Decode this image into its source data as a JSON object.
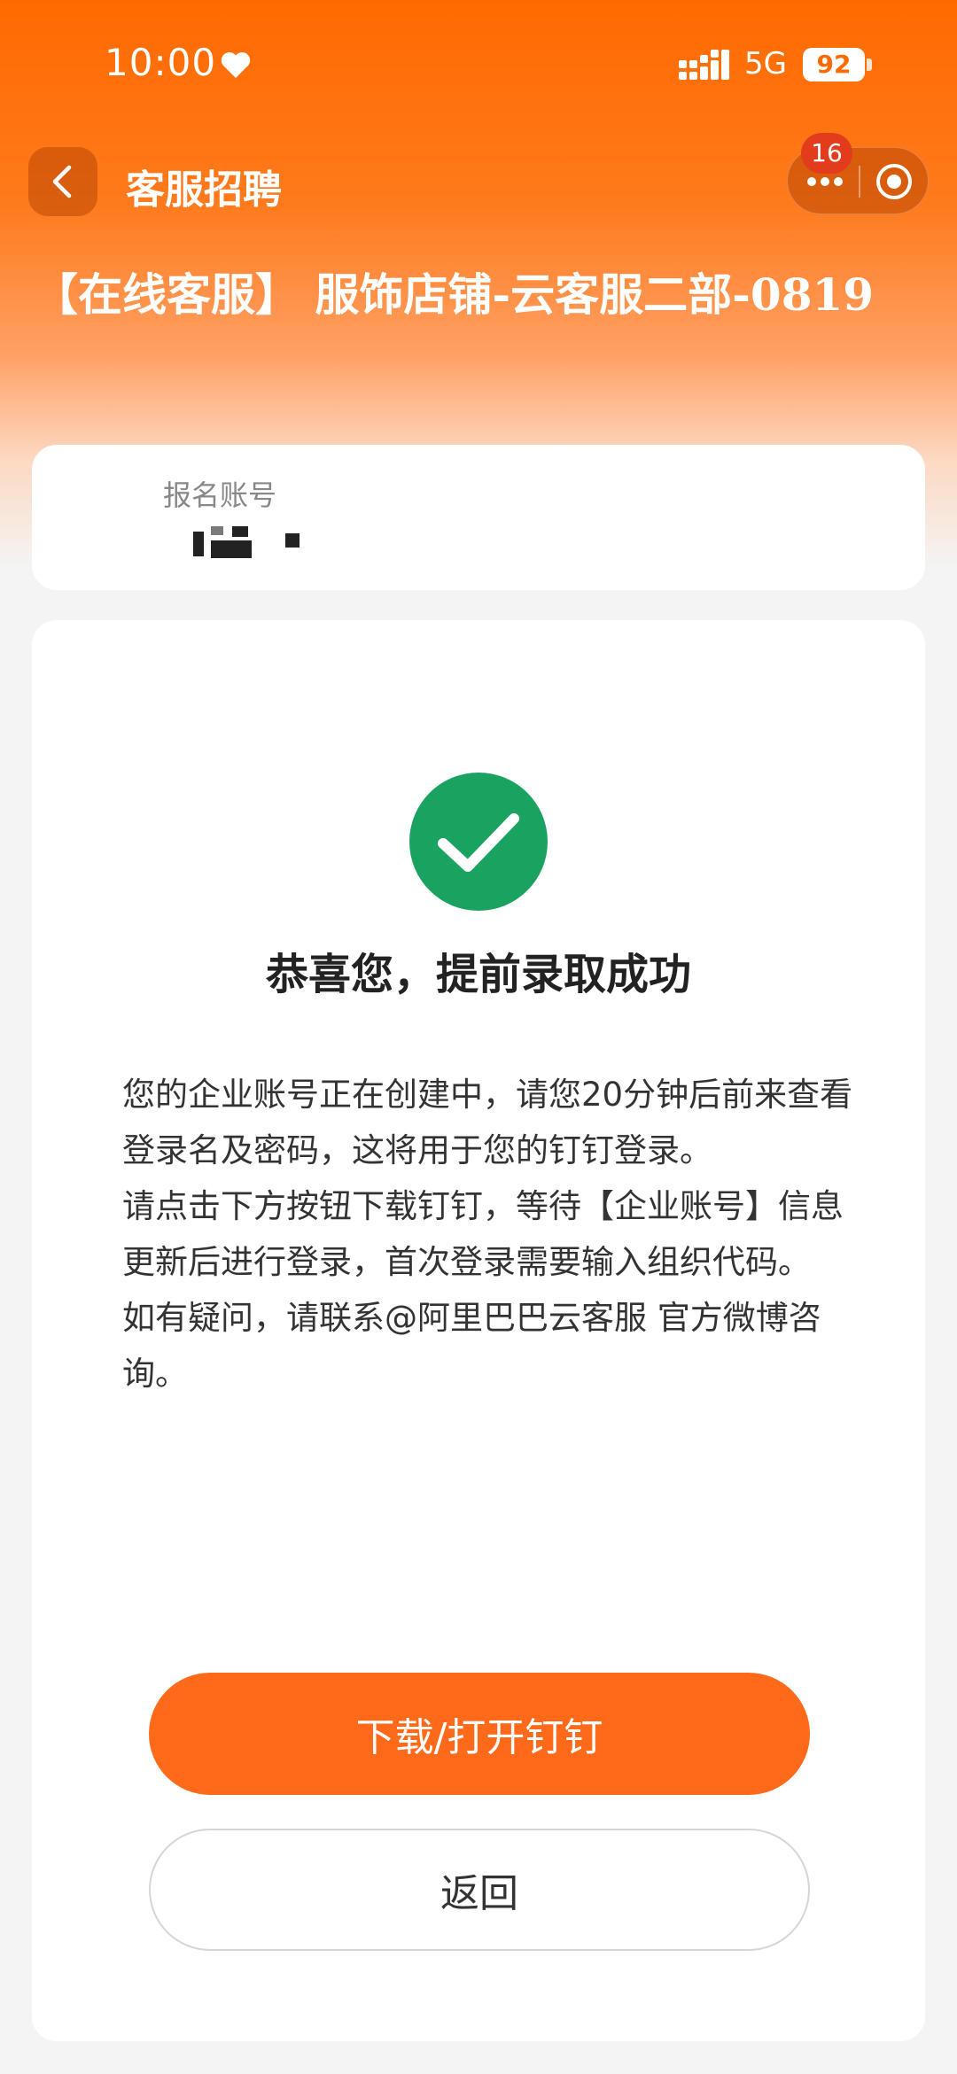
{
  "status_bar": {
    "time": "10:00",
    "network": "5G",
    "battery": "92",
    "icons": [
      "heart-icon",
      "signal-icon"
    ]
  },
  "nav": {
    "title": "客服招聘",
    "back_icon": "chevron-left-icon",
    "badge_count": "16",
    "capsule_icons": [
      "more-icon",
      "target-icon"
    ]
  },
  "job": {
    "title": "【在线客服】 服饰店铺-云客服二部-0819"
  },
  "account": {
    "label": "报名账号"
  },
  "result": {
    "icon": "check-circle-icon",
    "title": "恭喜您，提前录取成功",
    "paragraphs": [
      "您的企业账号正在创建中，请您20分钟后前来查看登录名及密码，这将用于您的钉钉登录。",
      "请点击下方按钮下载钉钉，等待【企业账号】信息更新后进行登录，首次登录需要输入组织代码。",
      "如有疑问，请联系@阿里巴巴云客服 官方微博咨询。"
    ]
  },
  "buttons": {
    "primary": "下载/打开钉钉",
    "secondary": "返回"
  },
  "colors": {
    "brand_orange": "#ff6a00",
    "button_orange": "#ff6a1a",
    "success_green": "#1aa260",
    "badge_red": "#e23c1c"
  }
}
